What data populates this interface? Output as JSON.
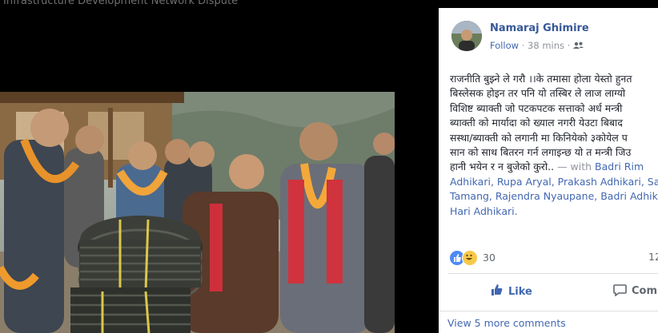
{
  "top": {
    "cut_title": "Infrastructure Development Network Dispute"
  },
  "author": {
    "name": "Namaraj Ghimire",
    "follow": "Follow",
    "time": "38 mins"
  },
  "post": {
    "lines": [
      "राजनीति बुझ्ने ले गरौ ।।के तमासा होला येस्तो हुनत",
      "बिस्लेसक होइन तर पनि यो तस्बिर ले लाज लाग्यो",
      "विशिष्ट ब्याक्ती जो पटकपटक सत्ताको अर्ध मन्त्री",
      "ब्याक्ती को मार्यादा को ख्याल नगरी येउटा बिबाद",
      "सस्था/ब्याक्ती को लगानी मा किनियेको ३कोयेल प",
      "सान को साथ बितरन गर्न लगाइन्छ यो त मन्त्री जिउ"
    ],
    "line7_text": "हानी भयेन र न बुजेको कुरो.. ",
    "with_label": "— with ",
    "tags_line7": "Badri Rim",
    "tags_line8": "Adhikari, Rupa Aryal, Prakash Adhikari, Sa",
    "tags_line9": "Tamang, Rajendra Nyaupane, Badri Adhik",
    "tags_line10": "Hari Adhikari."
  },
  "reactions": {
    "count": "30",
    "right_count": "12"
  },
  "actions": {
    "like": "Like",
    "comment": "Comm"
  },
  "comments": {
    "view_more": "View 5 more comments"
  },
  "colors": {
    "link": "#365899",
    "like_blue": "#4267b2",
    "muted": "#90949c"
  }
}
